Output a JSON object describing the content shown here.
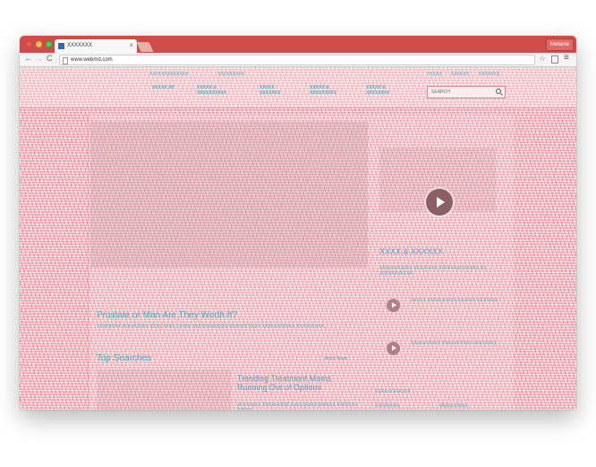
{
  "browser": {
    "tab_title": "XXXXXXX",
    "tab_close": "×",
    "profile_name": "Melanie",
    "url": "www.webmd.com",
    "back_glyph": "←",
    "forward_glyph": "→",
    "reload_glyph": "C",
    "star_glyph": "☆",
    "menu_glyph": "≡"
  },
  "site": {
    "top_links": [
      "XXXXXXXXXXXXX",
      "XXXXXXXXX",
      "XXXXX",
      "XXXXXX",
      "XXXXXXX"
    ],
    "nav_items": [
      "XXXXX XX",
      "XXXXX & XXXXXXXXXX",
      "XXXXX XXXXXXX",
      "XXXXX & XXXXXXXXX",
      "XXXXX & XXXXXXXX"
    ],
    "search_placeholder": "SEARCH",
    "hero_headline": "Prostate or Man Are They Worth It?",
    "hero_description": "XXXXXXXX XXXXXXXXX XXXX XXXX XXXXX XXXXXXXXXXXX XXXXXX XXXX XXXXXXXXXXX XX XXXXXXX",
    "sidebar_heading": "XXXX & XXXXXX",
    "sidebar_description": "XXXXXXXXXXX XXXXXXXX XXXXXXXX XXXXX XX XXXXXXXXXXX",
    "sidebar_items": [
      {
        "title": "XXXXX XXXXXXXXXX XXXXXX XXXXXXX"
      },
      {
        "title": "XXXXXXXXXX XXXXXXXXXX XXXXXXXX"
      }
    ],
    "top_searches_heading": "Top Searches",
    "more_news_label": "More News",
    "news_headline": "Trending Treatment Moms Running Out of Options",
    "news_subtitle": "XXXXXXXX XXXXXXXXX XXXXXXXXXXXXXXX XXXXXXX XXXXX",
    "footer_links": [
      "XXXXXXXXXXXX",
      "XXXXXXXX",
      "XXXXXXXXXX"
    ]
  }
}
